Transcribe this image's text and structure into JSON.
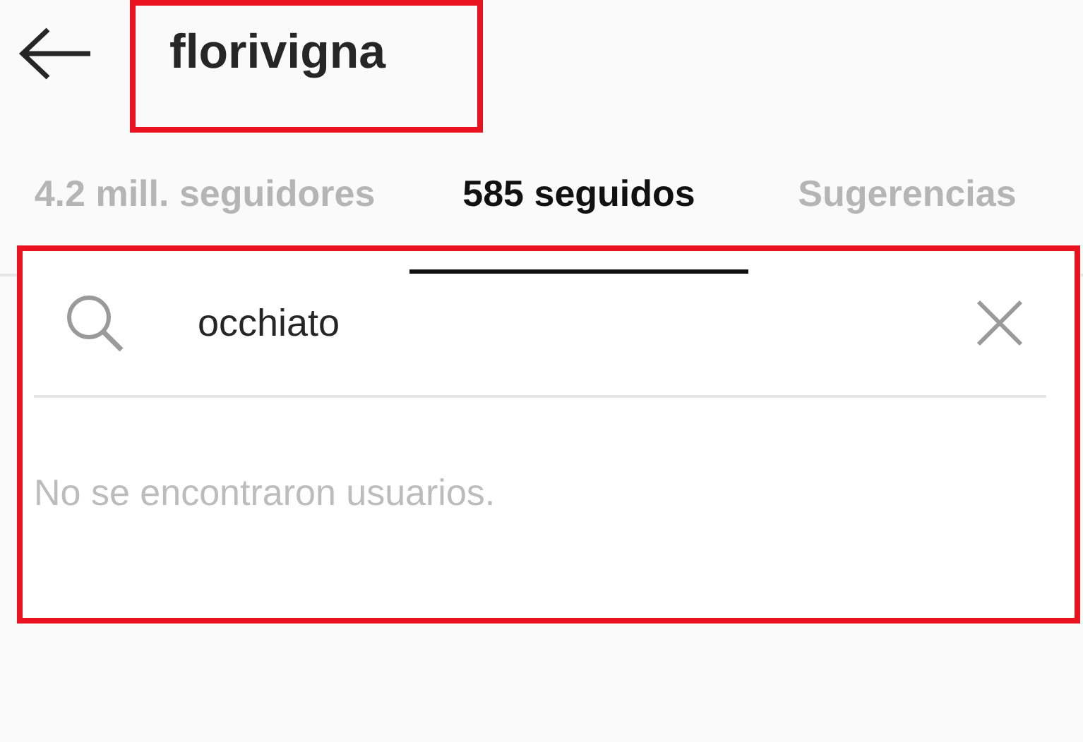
{
  "header": {
    "title": "florivigna"
  },
  "tabs": [
    {
      "label": "4.2 mill. seguidores",
      "selected": false
    },
    {
      "label": "585 seguidos",
      "selected": true
    },
    {
      "label": "Sugerencias",
      "selected": false
    }
  ],
  "search": {
    "value": "occhiato"
  },
  "empty_message": "No se encontraron usuarios."
}
